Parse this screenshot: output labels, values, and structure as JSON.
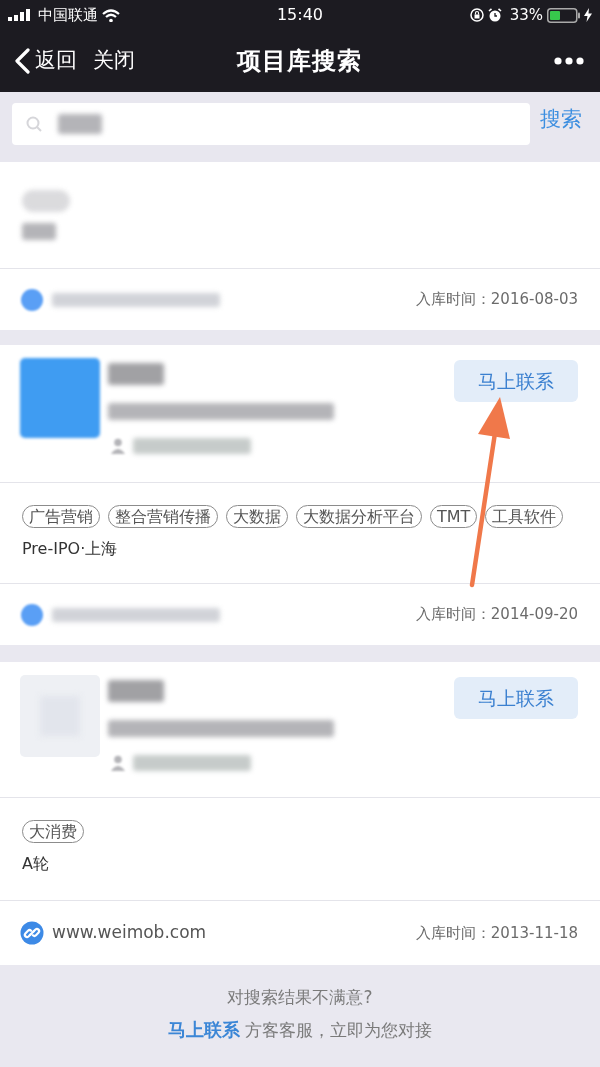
{
  "status_bar": {
    "carrier": "中国联通",
    "time": "15:40",
    "battery": "33%"
  },
  "nav": {
    "back": "返回",
    "close": "关闭",
    "title": "项目库搜索"
  },
  "search": {
    "query_blurred": true,
    "button": "搜索"
  },
  "results": [
    {
      "tag_blurred": true,
      "location_blurred": true,
      "website": {
        "kind": "blurred"
      },
      "added": "入库时间：2016-08-03"
    },
    {
      "header": {
        "logo": {
          "kind": "image"
        },
        "details_blurred": true
      },
      "contact_button": "马上联系",
      "pointer_arrow": true,
      "tags": [
        "广告营销",
        "整合营销传播",
        "大数据",
        "大数据分析平台",
        "TMT",
        "工具软件"
      ],
      "stage": "Pre-IPO·上海",
      "website": {
        "kind": "blurred"
      },
      "added": "入库时间：2014-09-20"
    },
    {
      "header": {
        "logo": {
          "kind": "placeholder"
        },
        "details_blurred": true
      },
      "contact_button": "马上联系",
      "tags": [
        "大消费"
      ],
      "stage": "A轮",
      "website": {
        "kind": "link",
        "text": "www.weimob.com"
      },
      "added": "入库时间：2013-11-18"
    }
  ],
  "footer": {
    "question": "对搜索结果不满意?",
    "link": "马上联系",
    "message": "方客客服，立即为您对接"
  }
}
